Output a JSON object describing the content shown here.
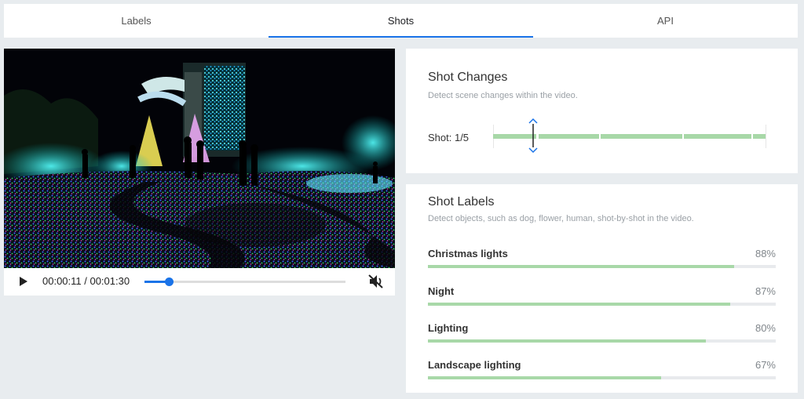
{
  "tabs": [
    {
      "label": "Labels",
      "active": false
    },
    {
      "label": "Shots",
      "active": true
    },
    {
      "label": "API",
      "active": false
    }
  ],
  "player": {
    "timecode": "00:00:11 / 00:01:30",
    "progress_fraction": 0.12,
    "play_icon": "play-icon",
    "mute_icon": "volume-muted-icon"
  },
  "shot_changes": {
    "title": "Shot Changes",
    "subtitle": "Detect scene changes within the video.",
    "shot_text": "Shot: 1/5",
    "current_shot": 1,
    "total_shots": 5
  },
  "shot_labels": {
    "title": "Shot Labels",
    "subtitle": "Detect objects, such as dog, flower, human, shot-by-shot in the video.",
    "items": [
      {
        "name": "Christmas lights",
        "percent": "88%",
        "value": 0.88
      },
      {
        "name": "Night",
        "percent": "87%",
        "value": 0.87
      },
      {
        "name": "Lighting",
        "percent": "80%",
        "value": 0.8
      },
      {
        "name": "Landscape lighting",
        "percent": "67%",
        "value": 0.67
      }
    ]
  },
  "colors": {
    "accent": "#1a73e8",
    "bar_fill": "#a8d8a8",
    "background": "#e8ecef"
  }
}
